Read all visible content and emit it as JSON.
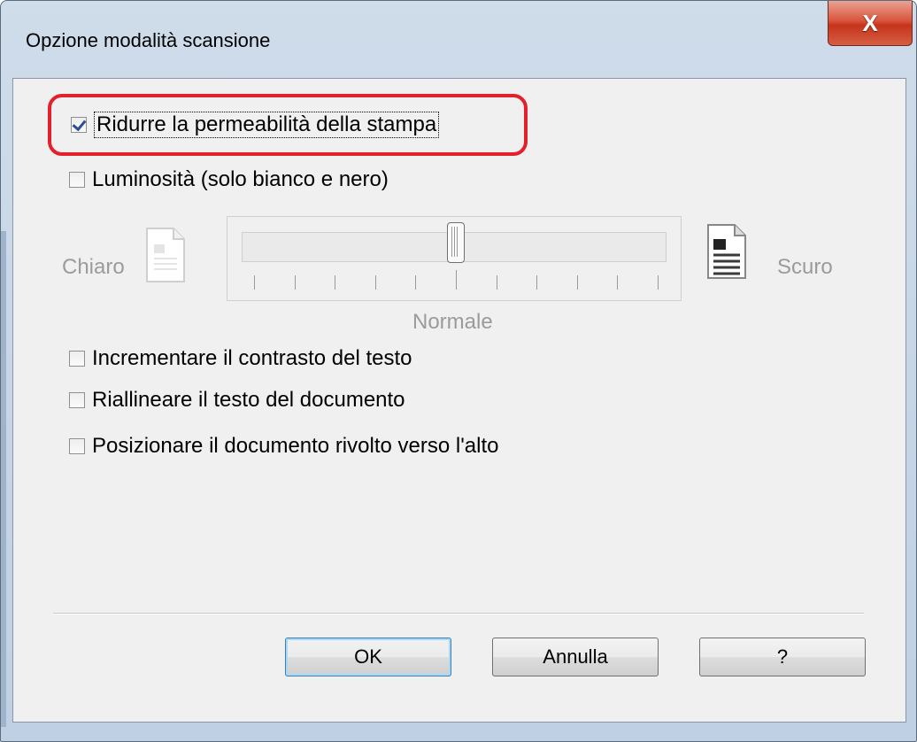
{
  "window": {
    "title": "Opzione modalità scansione",
    "close_label": "X"
  },
  "options": [
    {
      "label": "Ridurre la permeabilità della stampa",
      "checked": true
    },
    {
      "label": "Luminosità (solo bianco e nero)",
      "checked": false
    },
    {
      "label": "Incrementare il contrasto del testo",
      "checked": false
    },
    {
      "label": "Riallineare il testo del documento",
      "checked": false
    },
    {
      "label": "Posizionare il documento rivolto verso l'alto",
      "checked": false
    }
  ],
  "brightness": {
    "left_label": "Chiaro",
    "right_label": "Scuro",
    "center_label": "Normale",
    "value_fraction": 0.5,
    "enabled": false
  },
  "buttons": {
    "ok": "OK",
    "cancel": "Annulla",
    "help": "?"
  },
  "colors": {
    "highlight": "#e3202b",
    "close_button": "#c5341c"
  }
}
